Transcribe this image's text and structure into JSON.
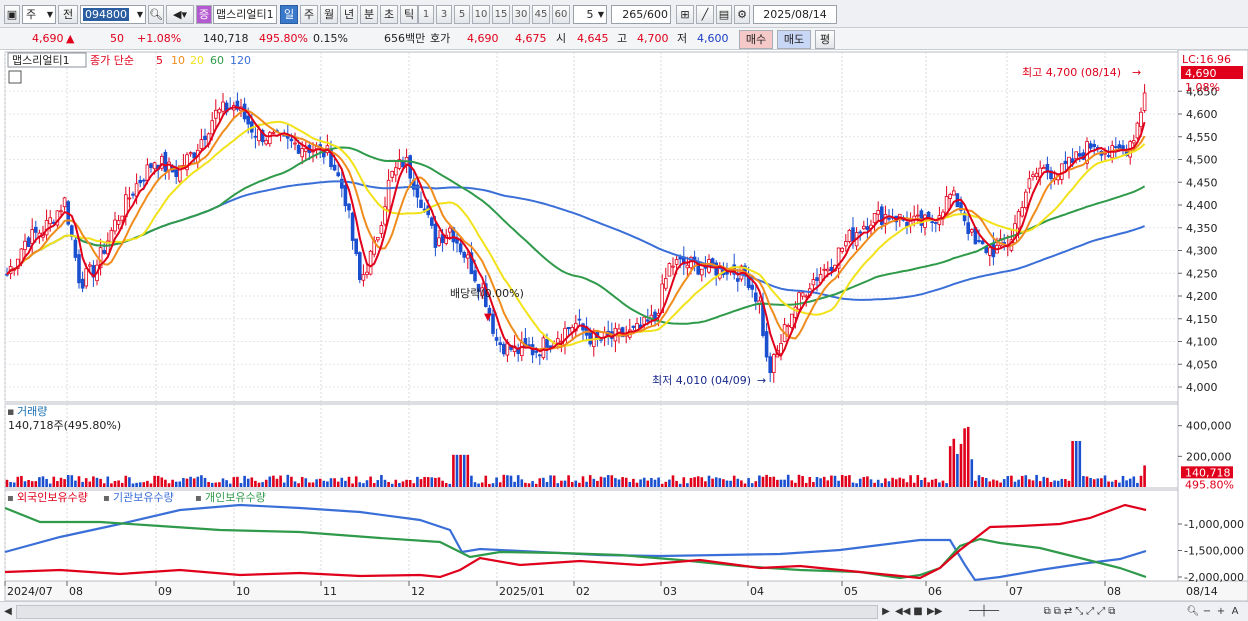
{
  "toolbar": {
    "market_label": "주",
    "prev_label": "전",
    "code_value": "094800",
    "stock_badge": "증",
    "stock_name": "맵스리얼티1",
    "periods": [
      "일",
      "주",
      "월",
      "년",
      "분",
      "초",
      "틱"
    ],
    "active_period": "일",
    "intervals": [
      "1",
      "3",
      "5",
      "10",
      "15",
      "30",
      "45",
      "60"
    ],
    "interval_value": "5",
    "count_value": "265",
    "count_total": "/600",
    "date_value": "2025/08/14"
  },
  "quote": {
    "price": "4,690",
    "change_arrow": "▲",
    "change": "50",
    "change_pct": "+1.08%",
    "volume": "140,718",
    "volume_ratio": "495.80%",
    "turnover": "0.15%",
    "trade_value": "656백만",
    "bid_ask_label": "호가",
    "ask": "4,690",
    "bid": "4,675",
    "open_label": "시",
    "open": "4,645",
    "high_label": "고",
    "high": "4,700",
    "low_label": "저",
    "low": "4,600",
    "buy_label": "매수",
    "sell_label": "매도",
    "eval_label": "평"
  },
  "price_pane": {
    "name_tag": "맵스리얼티1",
    "ma_title": "종가 단순",
    "ma_periods": [
      "5",
      "10",
      "20",
      "60",
      "120"
    ],
    "lc_label": "LC:16.96",
    "current_price_tag": "4,690",
    "current_pct": "1.08%",
    "high_note": "최고 4,700 (08/14)",
    "low_note": "최저 4,010 (04/09)",
    "dividend_note": "배당락(0.00%)",
    "y_ticks": [
      "4,650",
      "4,600",
      "4,550",
      "4,500",
      "4,450",
      "4,400",
      "4,350",
      "4,300",
      "4,250",
      "4,200",
      "4,150",
      "4,100",
      "4,050",
      "4,000"
    ]
  },
  "volume_pane": {
    "title": "거래량",
    "value_text": "140,718주(495.80%)",
    "y_ticks": [
      "400,000",
      "200,000"
    ],
    "tag_value": "140,718",
    "tag_pct": "495.80%"
  },
  "holdings_pane": {
    "legend": [
      "외국인보유수량",
      "기관보유수량",
      "개인보유수량"
    ],
    "y_ticks": [
      "-1,000,000",
      "-1,500,000",
      "-2,000,000"
    ]
  },
  "x_axis": [
    "2024/07",
    "08",
    "09",
    "10",
    "11",
    "12",
    "2025/01",
    "02",
    "03",
    "04",
    "05",
    "06",
    "07",
    "08"
  ],
  "x_axis_right": "08/14",
  "colors": {
    "up": "#e0001b",
    "down": "#1a4fd0",
    "ma5": "#e0001b",
    "ma10": "#f08c1c",
    "ma20": "#f2e21a",
    "ma60": "#2f9a4a",
    "ma120": "#3b6fd8",
    "foreign": "#e0001b",
    "institution": "#3b6fd8",
    "individual": "#2f9a4a"
  }
}
